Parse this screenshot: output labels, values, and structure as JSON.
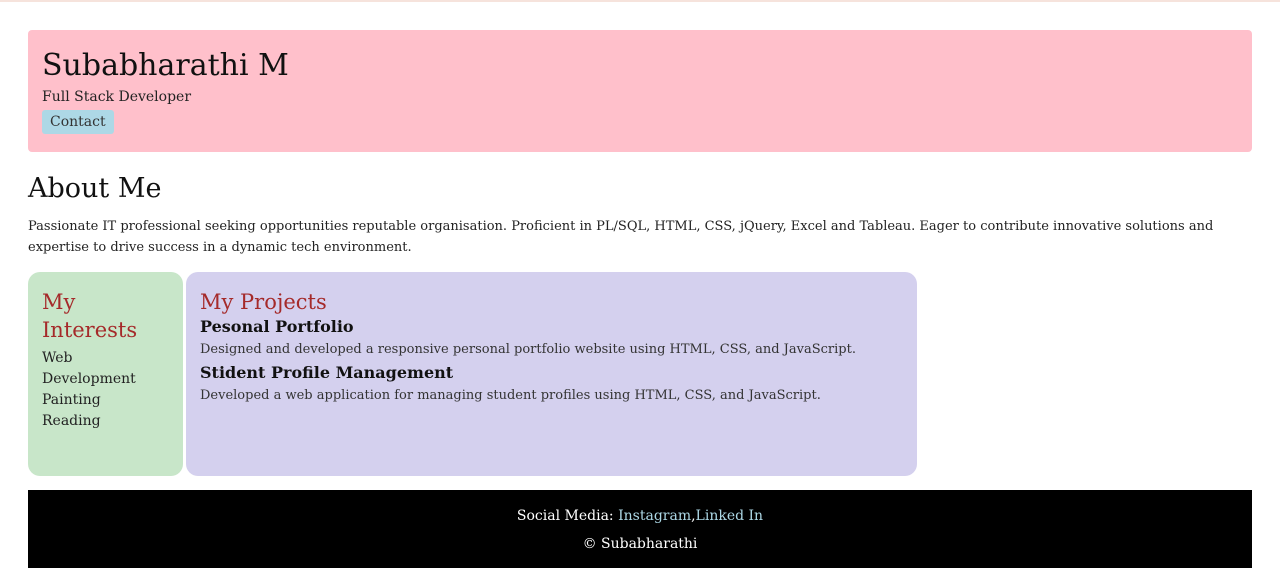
{
  "header": {
    "name": "Subabharathi M",
    "role": "Full Stack Developer",
    "contact_label": "Contact"
  },
  "about": {
    "title": "About Me",
    "text": "Passionate IT professional seeking opportunities reputable organisation. Proficient in PL/SQL, HTML, CSS, jQuery, Excel and Tableau. Eager to contribute innovative solutions and expertise to drive success in a dynamic tech environment."
  },
  "interests": {
    "title": "My Interests",
    "items": [
      "Web Development",
      "Painting",
      "Reading"
    ]
  },
  "projects": {
    "title": "My Projects",
    "items": [
      {
        "name": "Pesonal Portfolio",
        "description": "Designed and developed a responsive personal portfolio website using HTML, CSS, and JavaScript."
      },
      {
        "name": "Stident Profile Management",
        "description": "Developed a web application for managing student profiles using HTML, CSS, and JavaScript."
      }
    ]
  },
  "footer": {
    "social_label": "Social Media:",
    "instagram": "Instagram",
    "separator": ",",
    "linkedin": "Linked In",
    "copyright": "© Subabharathi"
  },
  "colors": {
    "header_bg": "#ffc0cb",
    "contact_bg": "#add8e6",
    "interests_bg": "#c8e6c9",
    "projects_bg": "#d4d0ee",
    "box_title": "#a52a2a",
    "footer_bg": "#000000",
    "footer_link": "#add8e6"
  }
}
